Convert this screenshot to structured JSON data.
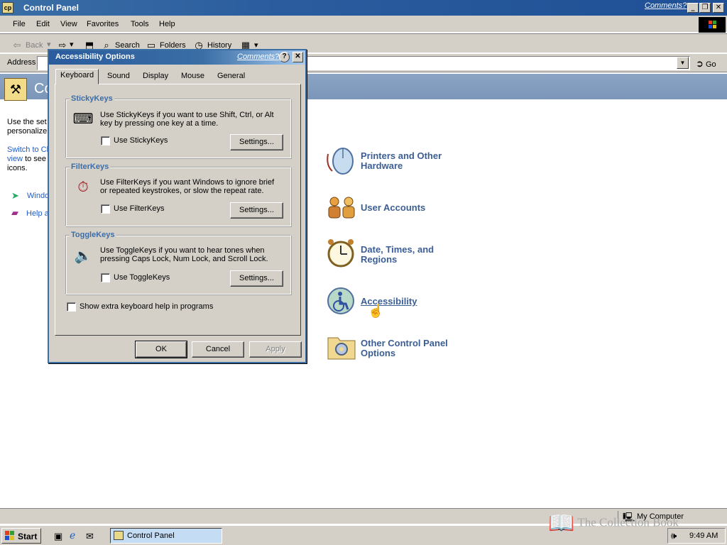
{
  "window": {
    "title": "Control Panel",
    "comments_label": "Comments?",
    "caption_min": "_",
    "caption_max": "❐",
    "caption_close": "✕"
  },
  "menu": [
    "File",
    "Edit",
    "View",
    "Favorites",
    "Tools",
    "Help"
  ],
  "toolbar": {
    "back": "Back",
    "search": "Search",
    "folders": "Folders",
    "history": "History"
  },
  "address": {
    "label": "Address",
    "value": "",
    "go_label": "Go"
  },
  "header": {
    "title": "Co"
  },
  "sidebar": {
    "text1_a": "Use the set",
    "text1_b": "personalize",
    "switch_a": "Switch to Cl",
    "switch_b": "view",
    "switch_c": "to see",
    "switch_d": "icons.",
    "link1": "Windo",
    "link2": "Help a"
  },
  "categories": [
    {
      "line1": "Printers and Other",
      "line2": "Hardware",
      "icon": "mouse-icon"
    },
    {
      "line1": "User Accounts",
      "line2": "",
      "icon": "users-icon"
    },
    {
      "line1": "Date, Times, and",
      "line2": "Regions",
      "icon": "clock-icon"
    },
    {
      "line1": "Accessibility",
      "line2": "",
      "icon": "accessibility-icon"
    },
    {
      "line1": "Other Control Panel",
      "line2": "Options",
      "icon": "folder-gear-icon"
    }
  ],
  "status": {
    "my_computer": "My Computer"
  },
  "taskbar": {
    "start": "Start",
    "task_label": "Control Panel",
    "clock": "9:49 AM"
  },
  "watermark": "The Collection Book",
  "dialog": {
    "title": "Accessibility Options",
    "comments_label": "Comments?",
    "help_btn": "?",
    "close_btn": "✕",
    "tabs": [
      "Keyboard",
      "Sound",
      "Display",
      "Mouse",
      "General"
    ],
    "active_tab": "Keyboard",
    "stickykeys": {
      "title": "StickyKeys",
      "text": "Use StickyKeys if you want to use Shift, Ctrl, or Alt key by pressing one key at a time.",
      "checkbox": "Use StickyKeys",
      "settings": "Settings..."
    },
    "filterkeys": {
      "title": "FilterKeys",
      "text": "Use FilterKeys if you want Windows to ignore brief or repeated keystrokes, or slow the repeat rate.",
      "checkbox": "Use FilterKeys",
      "settings": "Settings..."
    },
    "togglekeys": {
      "title": "ToggleKeys",
      "text": "Use ToggleKeys if you want to hear tones when pressing Caps Lock, Num Lock, and Scroll Lock.",
      "checkbox": "Use ToggleKeys",
      "settings": "Settings..."
    },
    "extra_help": "Show extra keyboard help in programs",
    "ok": "OK",
    "cancel": "Cancel",
    "apply": "Apply"
  }
}
